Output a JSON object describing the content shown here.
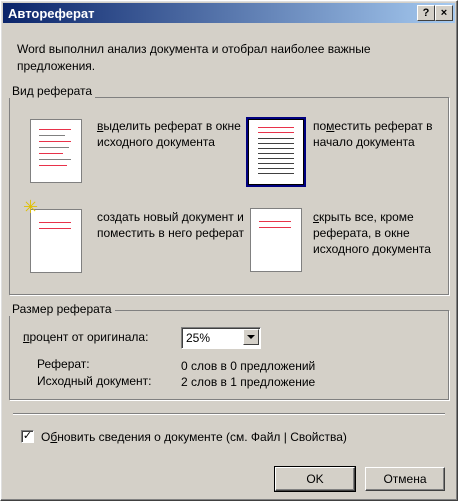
{
  "window": {
    "title": "Автореферат",
    "help_label": "?",
    "close_label": "×"
  },
  "intro_text": "Word выполнил анализ документа и отобрал наиболее важные предложения.",
  "type_group": {
    "label": "Вид реферата",
    "options": [
      {
        "pre": "",
        "mnemonic": "в",
        "post": "ыделить реферат в окне исходного документа"
      },
      {
        "pre": "по",
        "mnemonic": "м",
        "post": "естить реферат в начало документа"
      },
      {
        "pre": "соз",
        "mnemonic": "д",
        "post": "ать новый документ и поместить в  него реферат"
      },
      {
        "pre": "",
        "mnemonic": "с",
        "post": "крыть все, кроме реферата, в окне исходного документа"
      }
    ]
  },
  "size_group": {
    "label": "Размер реферата",
    "percent_label_pre": "",
    "percent_label_mnemonic": "п",
    "percent_label_post": "роцент от оригинала:",
    "percent_value": "25%",
    "summary_label": "Реферат:",
    "summary_value": "0 слов в 0 предложений",
    "source_label": "Исходный документ:",
    "source_value": "2 слов в 1 предложение"
  },
  "update_checkbox": {
    "checked": true,
    "check_mark": "✓",
    "label_pre": "О",
    "label_mnemonic": "б",
    "label_post": "новить сведения о документе (см. Файл | Свойства)"
  },
  "buttons": {
    "ok": "OK",
    "cancel": "Отмена"
  },
  "colors": {
    "title_start": "#0a246a",
    "title_end": "#a6caf0",
    "highlight_lines": "#e8324a"
  }
}
